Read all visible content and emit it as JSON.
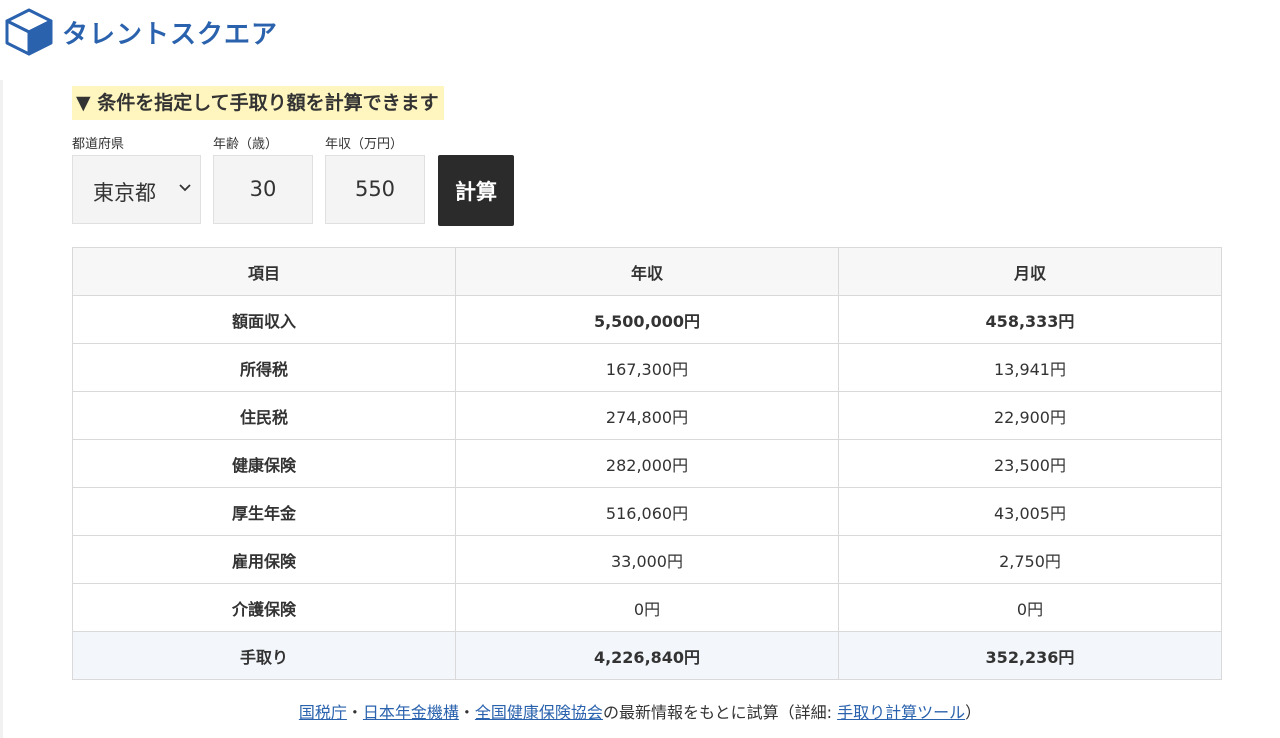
{
  "header": {
    "brand": "タレントスクエア"
  },
  "calculator": {
    "title": "▼ 条件を指定して手取り額を計算できます",
    "prefecture": {
      "label": "都道府県",
      "value": "東京都"
    },
    "age": {
      "label": "年齢（歳）",
      "value": "30"
    },
    "income": {
      "label": "年収（万円）",
      "value": "550"
    },
    "calc_label": "計算"
  },
  "table": {
    "headers": [
      "項目",
      "年収",
      "月収"
    ],
    "rows": [
      {
        "item": "額面収入",
        "annual": "5,500,000円",
        "monthly": "458,333円"
      },
      {
        "item": "所得税",
        "annual": "167,300円",
        "monthly": "13,941円"
      },
      {
        "item": "住民税",
        "annual": "274,800円",
        "monthly": "22,900円"
      },
      {
        "item": "健康保険",
        "annual": "282,000円",
        "monthly": "23,500円"
      },
      {
        "item": "厚生年金",
        "annual": "516,060円",
        "monthly": "43,005円"
      },
      {
        "item": "雇用保険",
        "annual": "33,000円",
        "monthly": "2,750円"
      },
      {
        "item": "介護保険",
        "annual": "0円",
        "monthly": "0円"
      },
      {
        "item": "手取り",
        "annual": "4,226,840円",
        "monthly": "352,236円"
      }
    ]
  },
  "footer": {
    "link1": "国税庁",
    "sep1": "・",
    "link2": "日本年金機構",
    "sep2": "・",
    "link3": "全国健康保険協会",
    "text_mid": "の最新情報をもとに試算（詳細: ",
    "link4": "手取り計算ツール",
    "text_end": "）"
  },
  "colors": {
    "brand_blue": "#2a62ad",
    "title_highlight": "#fff6bf",
    "button_dark": "#2b2b2b",
    "total_row_bg": "#f3f7fb"
  }
}
